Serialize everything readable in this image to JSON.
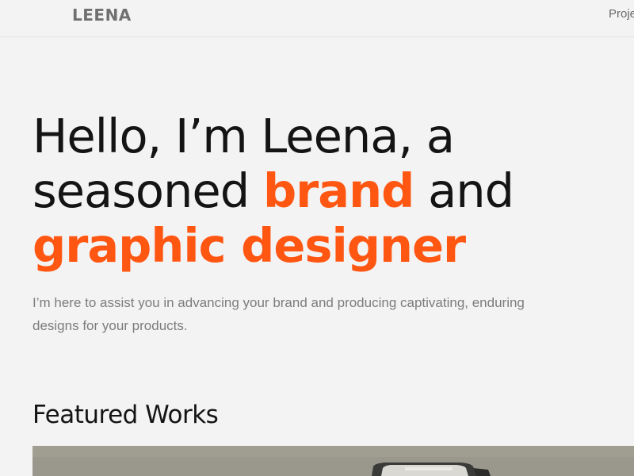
{
  "header": {
    "logo": "LEENA",
    "nav_partial": "Proje"
  },
  "hero": {
    "line1": "Hello, I’m Leena, a",
    "line2_pre": "seasoned ",
    "line2_accent": "brand",
    "line2_post": " and",
    "line3_accent": "graphic designer",
    "subtitle": "I’m here to assist you in advancing your brand and producing captivating, enduring designs for your products."
  },
  "featured": {
    "title": "Featured Works"
  },
  "colors": {
    "accent": "#ff5612",
    "text": "#141414",
    "muted": "#7c7c7c",
    "background": "#f3f3f3"
  }
}
